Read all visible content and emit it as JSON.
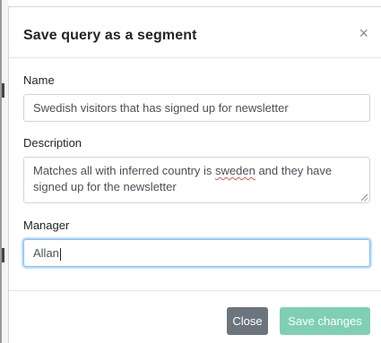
{
  "modal": {
    "title": "Save query as a segment",
    "close_glyph": "×",
    "close_icon": "close-icon"
  },
  "form": {
    "name_label": "Name",
    "name_value": "Swedish visitors that has signed up for newsletter",
    "description_label": "Description",
    "description_value_before": "Matches all with inferred country is ",
    "description_value_misspelled": "sweden",
    "description_value_after": " and they have signed up for the newsletter",
    "manager_label": "Manager",
    "manager_value": "Allan"
  },
  "footer": {
    "close_label": "Close",
    "save_label": "Save changes"
  },
  "colors": {
    "close_button": "#6c757d",
    "save_button": "#7fd0b2",
    "focus_border": "#80bdff"
  }
}
